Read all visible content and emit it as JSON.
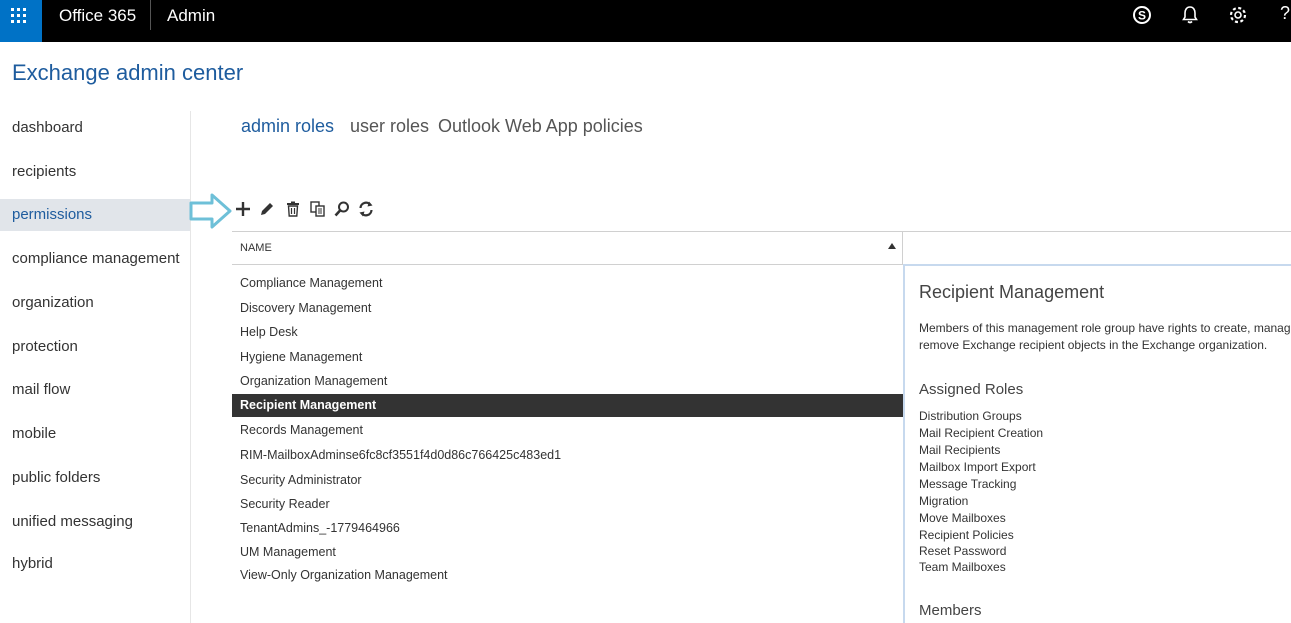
{
  "topbar": {
    "brand": "Office 365",
    "app": "Admin",
    "icons": [
      "waffle-icon",
      "skype-icon",
      "bell-icon",
      "gear-icon",
      "help-icon"
    ],
    "help_glyph": "?",
    "colors": {
      "bar": "#000000",
      "waffle": "#0072c6"
    }
  },
  "title": "Exchange admin center",
  "nav": {
    "items": [
      {
        "label": "dashboard"
      },
      {
        "label": "recipients"
      },
      {
        "label": "permissions",
        "active": true
      },
      {
        "label": "compliance management"
      },
      {
        "label": "organization"
      },
      {
        "label": "protection"
      },
      {
        "label": "mail flow"
      },
      {
        "label": "mobile"
      },
      {
        "label": "public folders"
      },
      {
        "label": "unified messaging"
      },
      {
        "label": "hybrid"
      }
    ]
  },
  "tabs": [
    {
      "label": "admin roles",
      "active": true
    },
    {
      "label": "user roles"
    },
    {
      "label": "Outlook Web App policies"
    }
  ],
  "toolbar": {
    "icons": [
      "add-icon",
      "edit-icon",
      "delete-icon",
      "copy-icon",
      "search-icon",
      "refresh-icon"
    ]
  },
  "table": {
    "column": "NAME",
    "sort": "ascending",
    "rows": [
      "Compliance Management",
      "Discovery Management",
      "Help Desk",
      "Hygiene Management",
      "Organization Management",
      "Recipient Management",
      "Records Management",
      "RIM-MailboxAdminse6fc8cf3551f4d0d86c766425c483ed1",
      "Security Administrator",
      "Security Reader",
      "TenantAdmins_-1779464966",
      "UM Management",
      "View-Only Organization Management"
    ],
    "selected": "Recipient Management"
  },
  "detail": {
    "title": "Recipient Management",
    "description_line1": "Members of this management role group have rights to create, manag",
    "description_line2": "remove Exchange recipient objects in the Exchange organization.",
    "assigned_roles_heading": "Assigned Roles",
    "assigned_roles": [
      "Distribution Groups",
      "Mail Recipient Creation",
      "Mail Recipients",
      "Mailbox Import Export",
      "Message Tracking",
      "Migration",
      "Move Mailboxes",
      "Recipient Policies",
      "Reset Password",
      "Team Mailboxes"
    ],
    "members_heading": "Members"
  }
}
